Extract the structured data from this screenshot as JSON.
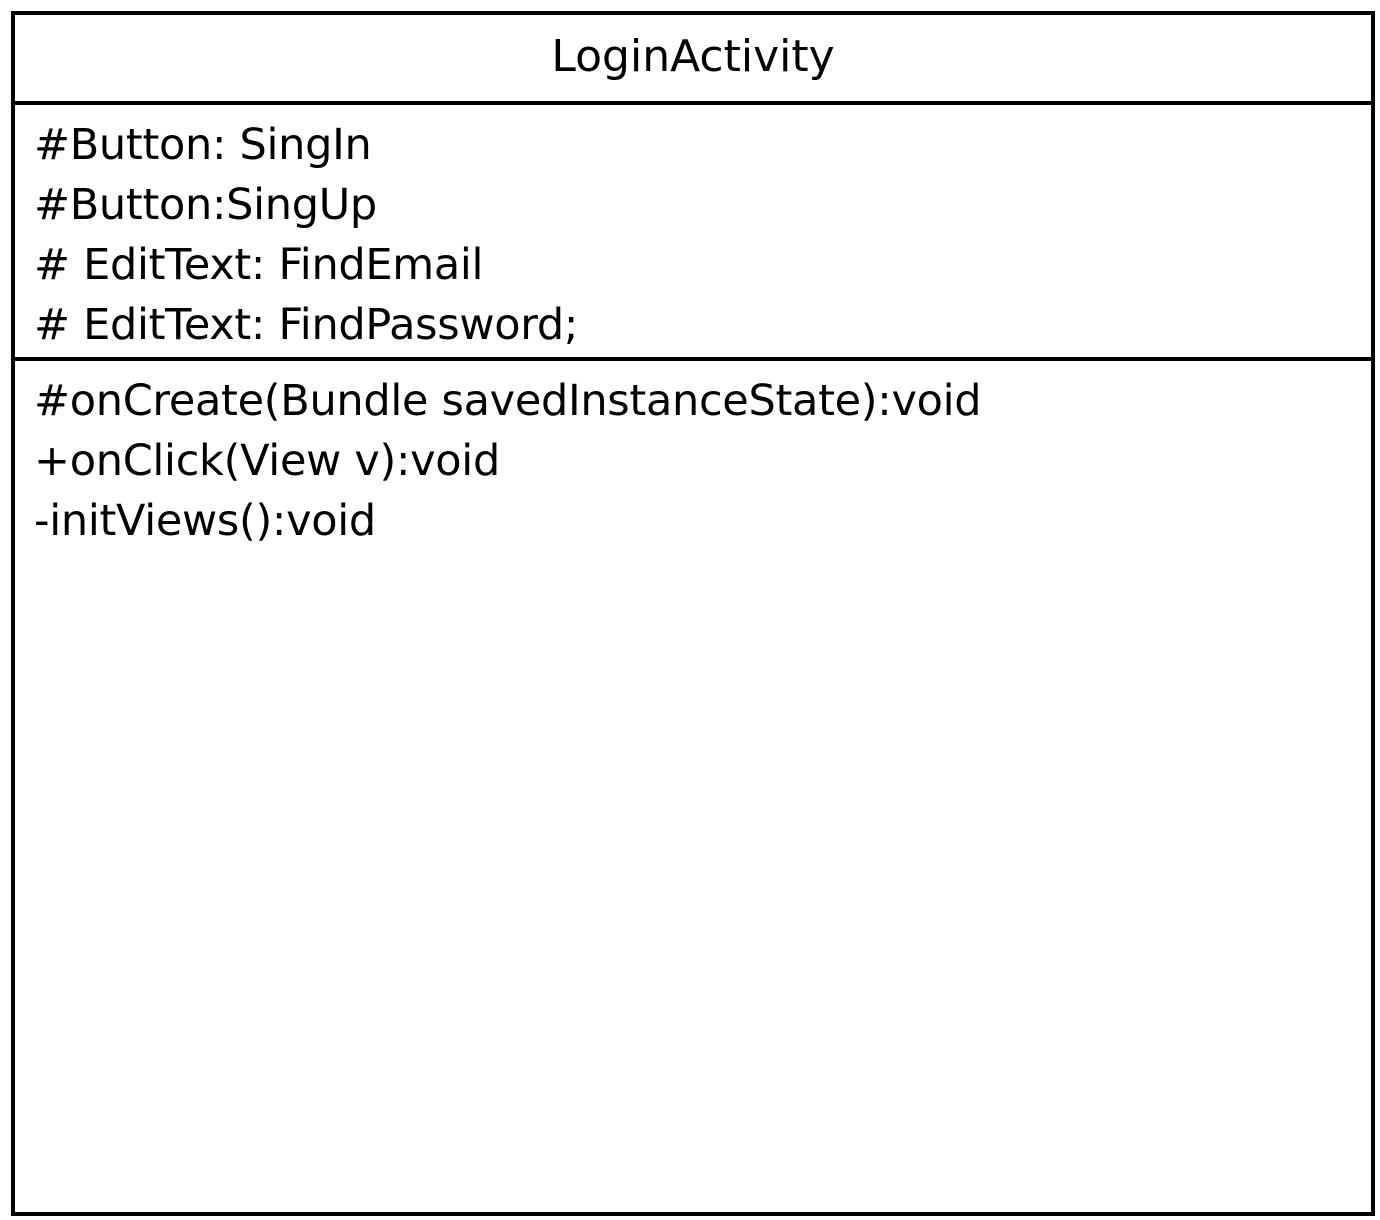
{
  "class": {
    "name": "LoginActivity",
    "attributes": [
      "#Button: SingIn",
      "#Button:SingUp",
      "# EditText: FindEmail",
      "# EditText: FindPassword;"
    ],
    "operations": [
      "#onCreate(Bundle savedInstanceState):void",
      "+onClick(View v):void",
      "-initViews():void"
    ]
  },
  "colors": {
    "border": "#000000",
    "background": "#ffffff",
    "text": "#000000"
  }
}
